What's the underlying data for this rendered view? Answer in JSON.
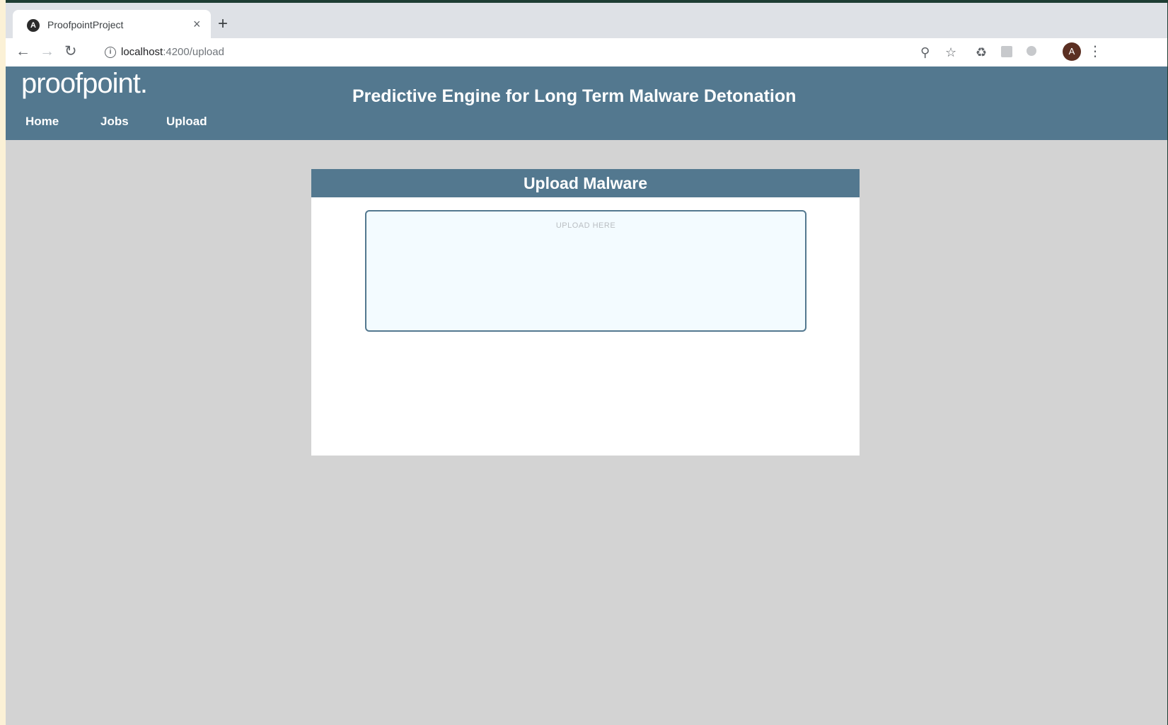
{
  "browser": {
    "tab_title": "ProofpointProject",
    "tab_close": "×",
    "new_tab": "+",
    "url_host": "localhost",
    "url_rest": ":4200/upload",
    "avatar_letter": "A",
    "icons": [
      "back-icon",
      "forward-icon",
      "reload-icon",
      "info-icon",
      "zoom-icon",
      "star-icon",
      "recycle-icon",
      "extension-icon",
      "shield-icon",
      "menu-icon"
    ]
  },
  "app": {
    "logo": "proofpoint.",
    "title": "Predictive Engine for Long Term Malware Detonation",
    "nav": [
      {
        "label": "Home"
      },
      {
        "label": "Jobs"
      },
      {
        "label": "Upload"
      }
    ]
  },
  "upload_card": {
    "header": "Upload Malware",
    "dropzone_label": "UPLOAD HERE"
  },
  "colors": {
    "header_bg": "#53788f",
    "page_bg": "#d3d3d3",
    "dropzone_bg": "#f3fbff"
  }
}
